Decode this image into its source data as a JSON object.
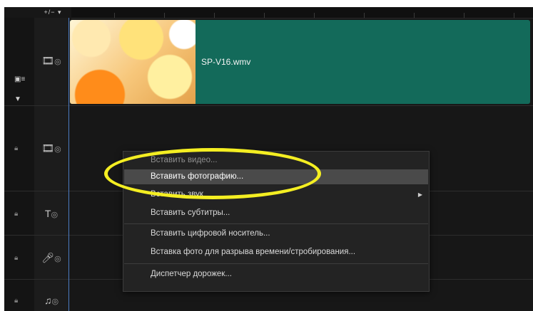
{
  "timeline": {
    "add_remove_label": "+/− ▾",
    "clip": {
      "name": "SP-V16.wmv"
    }
  },
  "context_menu": {
    "items": [
      {
        "label": "Вставить видео..."
      },
      {
        "label": "Вставить фотографию..."
      },
      {
        "label": "Вставить звук"
      },
      {
        "label": "Вставить субтитры..."
      },
      {
        "label": "Вставить цифровой носитель..."
      },
      {
        "label": "Вставка фото для разрыва времени/стробирования..."
      },
      {
        "label": "Диспетчер дорожек..."
      }
    ],
    "highlighted_item": "Вставить фотографию..."
  },
  "annotation": {
    "color": "#f4ee22"
  },
  "colors": {
    "clip": "#136a5a",
    "playhead": "#4d7cc4",
    "background": "#171717"
  }
}
